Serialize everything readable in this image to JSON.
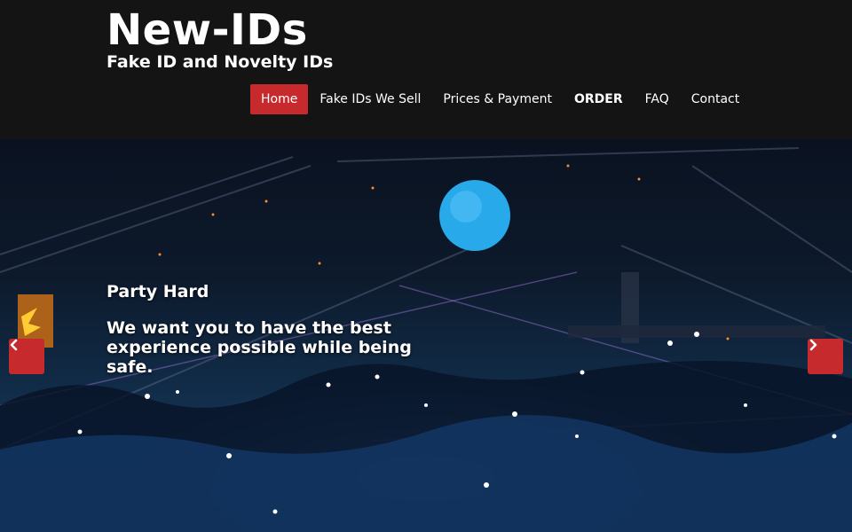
{
  "site": {
    "title": "New-IDs",
    "tagline": "Fake ID and Novelty IDs"
  },
  "nav": {
    "items": [
      {
        "label": "Home",
        "active": true
      },
      {
        "label": "Fake IDs We Sell"
      },
      {
        "label": "Prices & Payment"
      },
      {
        "label": "ORDER",
        "bold": true
      },
      {
        "label": "FAQ"
      },
      {
        "label": "Contact"
      }
    ]
  },
  "slider": {
    "caption_title": "Party Hard",
    "caption_body": "We want you to have the best experience possible while being safe.",
    "prev_icon": "chevron-left-icon",
    "next_icon": "chevron-right-icon"
  },
  "colors": {
    "accent": "#c62a2d",
    "header_bg": "#141414"
  }
}
